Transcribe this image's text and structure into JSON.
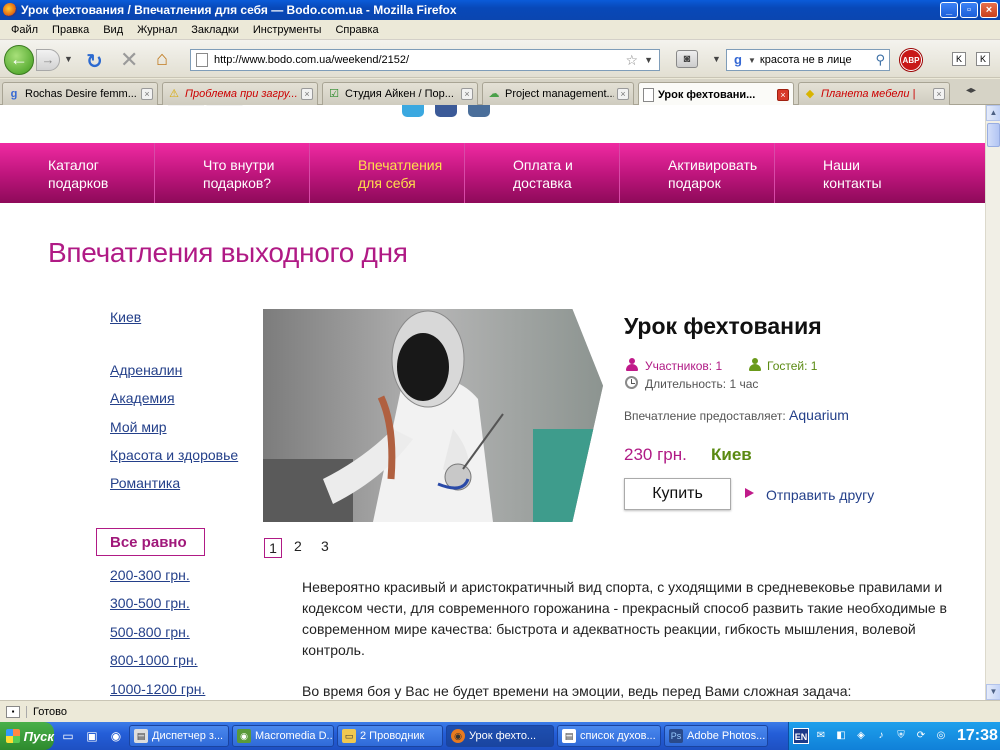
{
  "window": {
    "title": "Урок фехтования / Впечатления для себя — Bodo.com.ua - Mozilla Firefox"
  },
  "menu": [
    "Файл",
    "Правка",
    "Вид",
    "Журнал",
    "Закладки",
    "Инструменты",
    "Справка"
  ],
  "navbar": {
    "url": "http://www.bodo.com.ua/weekend/2152/",
    "search_value": "красота не в лице",
    "abp_label": "ABP",
    "k1": "K",
    "k2": "K"
  },
  "tabs": [
    {
      "label": "Rochas Desire femm...",
      "icon": "google-icon"
    },
    {
      "label": "Проблема при загру...",
      "icon": "warning-icon"
    },
    {
      "label": "Студия Айкен / Пор...",
      "icon": "check-icon"
    },
    {
      "label": "Project management...",
      "icon": "cloud-icon"
    },
    {
      "label": "Урок фехтовани...",
      "icon": "page-icon",
      "active": true
    },
    {
      "label": "Планета мебели |",
      "icon": "diamond-icon"
    }
  ],
  "site_nav": [
    {
      "line1": "Каталог",
      "line2": "подарков"
    },
    {
      "line1": "Что внутри",
      "line2": "подарков?"
    },
    {
      "line1": "Впечатления",
      "line2": "для себя"
    },
    {
      "line1": "Оплата и",
      "line2": "доставка"
    },
    {
      "line1": "Активировать",
      "line2": "подарок"
    },
    {
      "line1": "Наши",
      "line2": "контакты"
    }
  ],
  "page": {
    "heading": "Впечатления выходного дня"
  },
  "sidebar": {
    "city": "Киев",
    "categories": [
      "Адреналин",
      "Академия",
      "Мой мир",
      "Красота и здоровье",
      "Романтика"
    ],
    "price_all": "Все равно",
    "prices": [
      "200-300 грн.",
      "300-500 грн.",
      "500-800 грн.",
      "800-1000 грн.",
      "1000-1200 грн."
    ]
  },
  "gallery": {
    "pages": [
      "1",
      "2",
      "3"
    ]
  },
  "product": {
    "title": "Урок фехтования",
    "participants": "Участников: 1",
    "guests": "Гостей: 1",
    "duration": "Длительность: 1 час",
    "provider_label": "Впечатление предоставляет:",
    "provider": "Aquarium",
    "price": "230 грн.",
    "city": "Киев",
    "buy_label": "Купить",
    "send_label": "Отправить другу"
  },
  "description": {
    "p1": "Невероятно красивый и аристократичный вид спорта, с уходящими в средневековье правилами и кодексом чести, для современного горожанина - прекрасный способ развить такие необходимые в современном мире качества: быстрота и адекватность реакции, гибкость мышления, волевой контроль.",
    "p2": "Во время боя у Вас не будет времени на эмоции, ведь перед Вами сложная задача:"
  },
  "status": {
    "text": "Готово"
  },
  "taskbar": {
    "start": "Пуск",
    "items": [
      {
        "label": "Диспетчер з..."
      },
      {
        "label": "Macromedia D..."
      },
      {
        "label": "2 Проводник"
      },
      {
        "label": "Урок фехто...",
        "active": true
      },
      {
        "label": "список духов..."
      },
      {
        "label": "Adobe Photos..."
      }
    ],
    "lang": "EN",
    "clock": "17:38"
  },
  "colors": {
    "brand_pink": "#b01a85",
    "nav_active": "#ffe04a",
    "city_green": "#5a8a12",
    "link_blue": "#24408a"
  }
}
